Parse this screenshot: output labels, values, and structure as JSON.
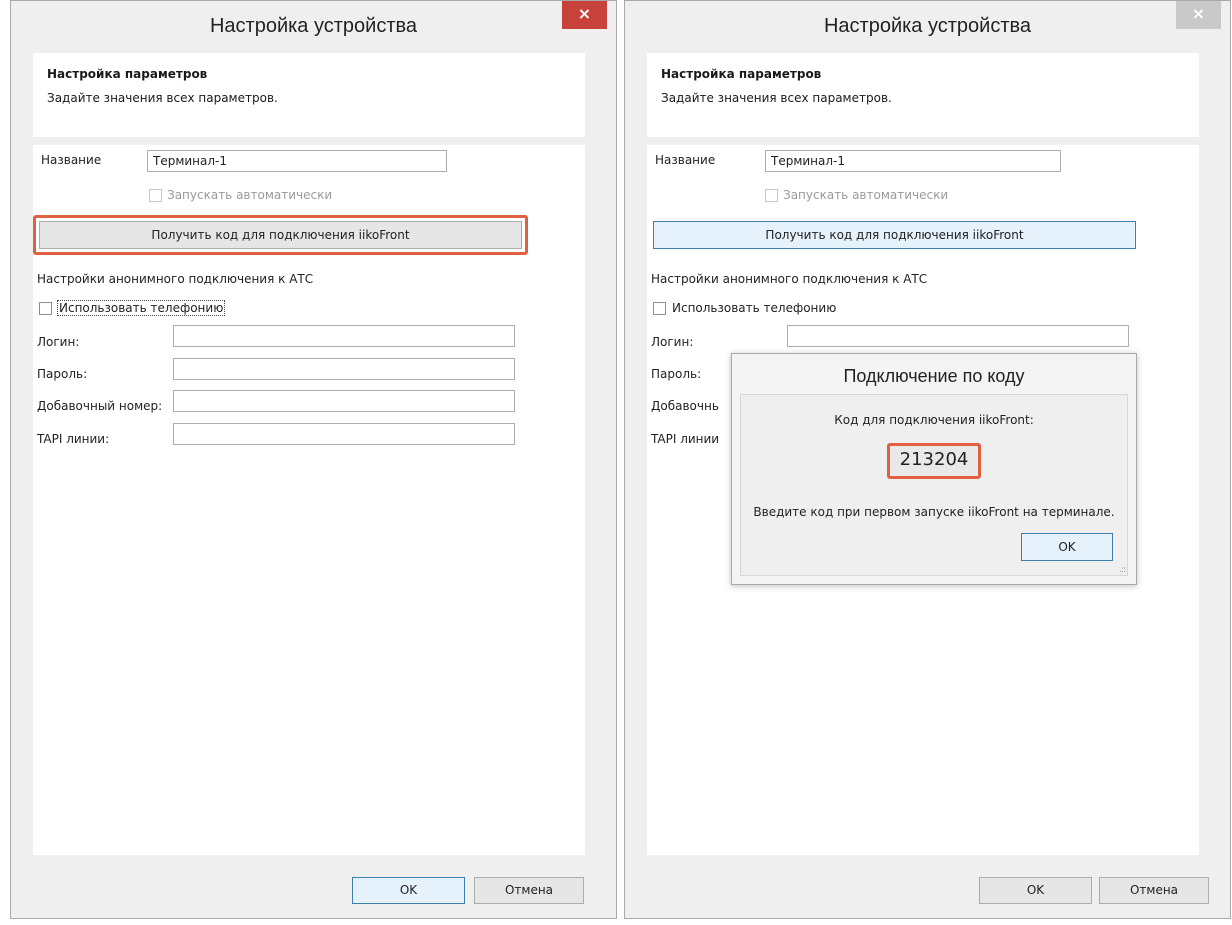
{
  "left_window": {
    "title": "Настройка устройства",
    "close_glyph": "×",
    "header": {
      "title": "Настройка параметров",
      "subtitle": "Задайте значения всех параметров."
    },
    "form": {
      "name_label": "Название",
      "name_value": "Терминал-1",
      "autostart_label": "Запускать автоматически",
      "get_code_button": "Получить код для подключения iikoFront",
      "anon_section_title": "Настройки анонимного подключения к АТС",
      "use_telephony_label": "Использовать телефонию",
      "login_label": "Логин:",
      "password_label": "Пароль:",
      "extension_label": "Добавочный номер:",
      "tapi_label": "TAPI линии:"
    },
    "footer": {
      "ok_label": "OK",
      "cancel_label": "Отмена"
    }
  },
  "right_window": {
    "title": "Настройка устройства",
    "close_glyph": "×",
    "header": {
      "title": "Настройка параметров",
      "subtitle": "Задайте значения всех параметров."
    },
    "form": {
      "name_label": "Название",
      "name_value": "Терминал-1",
      "autostart_label": "Запускать автоматически",
      "get_code_button": "Получить код для подключения iikoFront",
      "anon_section_title": "Настройки анонимного подключения к АТС",
      "use_telephony_label": "Использовать телефонию",
      "login_label": "Логин:",
      "password_label": "Пароль:",
      "extension_label_partial": "Добавочнь",
      "tapi_label_partial": "TAPI линии"
    },
    "footer": {
      "ok_label": "OK",
      "cancel_label": "Отмена"
    },
    "dialog": {
      "title": "Подключение по коду",
      "code_caption": "Код для подключения iikoFront:",
      "code": "213204",
      "instruction": "Введите код при первом запуске iikoFront на терминале.",
      "ok_label": "OK",
      "resize_grip": ".::"
    }
  },
  "colors": {
    "highlight": "#e0603f",
    "close_active": "#c7423a",
    "close_inactive": "#c9c9c9",
    "focus_border": "#3c7fb1"
  }
}
